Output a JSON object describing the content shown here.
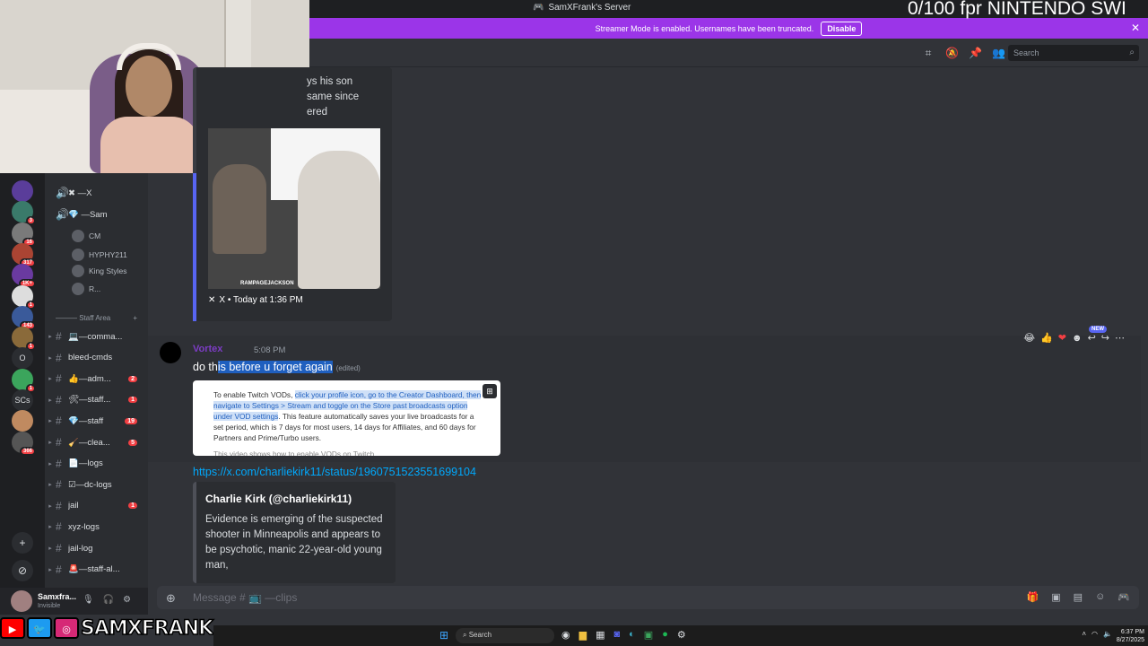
{
  "window": {
    "title": "SamXFrank's Server"
  },
  "stream_overlay": {
    "goal_text": "0/100 fpr NINTENDO SWI"
  },
  "banner": {
    "text": "Streamer Mode is enabled. Usernames have been truncated.",
    "disable_label": "Disable",
    "close": "✕"
  },
  "header": {
    "search_placeholder": "Search"
  },
  "servers": [
    {
      "color": "#5a3d9a",
      "badge": ""
    },
    {
      "color": "#3a7a6a",
      "badge": "3"
    },
    {
      "color": "#7a7a7a",
      "badge": "16"
    },
    {
      "color": "#aa4433",
      "badge": "317"
    },
    {
      "color": "#6a3aa0",
      "badge": "1K+"
    },
    {
      "color": "#dddddd",
      "badge": "1"
    },
    {
      "color": "#3a5a9a",
      "badge": "143"
    },
    {
      "color": "#8a6a3a",
      "badge": "1"
    },
    {
      "color": "#2b2d31",
      "badge": "",
      "text": "O"
    },
    {
      "color": "#3ba55c",
      "badge": "1"
    },
    {
      "color": "#2b2d31",
      "badge": "",
      "text": "SCs"
    },
    {
      "color": "#c08a60",
      "badge": ""
    },
    {
      "color": "#555555",
      "badge": "366"
    }
  ],
  "voice_channels": [
    {
      "label": "✖ —X"
    },
    {
      "label": "💎 —Sam"
    }
  ],
  "voice_users": [
    "CM",
    "HYPHY211",
    "King Styles",
    "R..."
  ],
  "category": {
    "label": "——— Staff Area"
  },
  "channels": [
    {
      "label": "💻—comma...",
      "count": ""
    },
    {
      "label": "bleed-cmds",
      "count": ""
    },
    {
      "label": "👍—adm...",
      "count": "2"
    },
    {
      "label": "🛠—staff...",
      "count": "1"
    },
    {
      "label": "💎—staff",
      "count": "19"
    },
    {
      "label": "🧹—clea...",
      "count": "5"
    },
    {
      "label": "📄—logs",
      "count": ""
    },
    {
      "label": "☑—dc-logs",
      "count": ""
    },
    {
      "label": "jail",
      "count": "1"
    },
    {
      "label": "xyz-logs",
      "count": ""
    },
    {
      "label": "jail-log",
      "count": ""
    },
    {
      "label": "🚨—staff-al...",
      "count": ""
    }
  ],
  "user_panel": {
    "name": "Samxfra...",
    "status": "Invisible"
  },
  "messages": {
    "embed1": {
      "text_lines": [
        "ys his son",
        "same since",
        "ered"
      ],
      "footer": "X • Today at 1:36 PM",
      "video_caption": "RAMPAGEJACKSON"
    },
    "msg2": {
      "author": "Vortex",
      "time": "5:08 PM",
      "text_pre": "do th",
      "text_hl": "is before u forget again",
      "edited": "(edited)",
      "embed_pre": "To enable Twitch VODs, ",
      "embed_sel": "click your profile icon, go to the Creator Dashboard, then navigate to Settings > Stream and toggle on the Store past broadcasts option under VOD settings",
      "embed_post": ". This feature automatically saves your live broadcasts for a set period, which is 7 days for most users, 14 days for Affiliates, and 60 days for Partners and Prime/Turbo users.",
      "embed_cut": "This video shows how to enable VODs on Twitch"
    },
    "link": "https://x.com/charliekirk11/status/1960751523551699104",
    "embed3": {
      "author": "Charlie Kirk (@charliekirk11)",
      "desc": "Evidence is emerging of the suspected shooter in Minneapolis and appears to be psychotic, manic 22-year-old young man,"
    }
  },
  "reactions": {
    "new_tag": "NEW"
  },
  "composer": {
    "placeholder": "Message # 📺 —clips"
  },
  "socials": {
    "handle": "SAMXFRANK"
  },
  "taskbar": {
    "search": "Search",
    "time": "6:37 PM",
    "date": "8/27/2025"
  }
}
